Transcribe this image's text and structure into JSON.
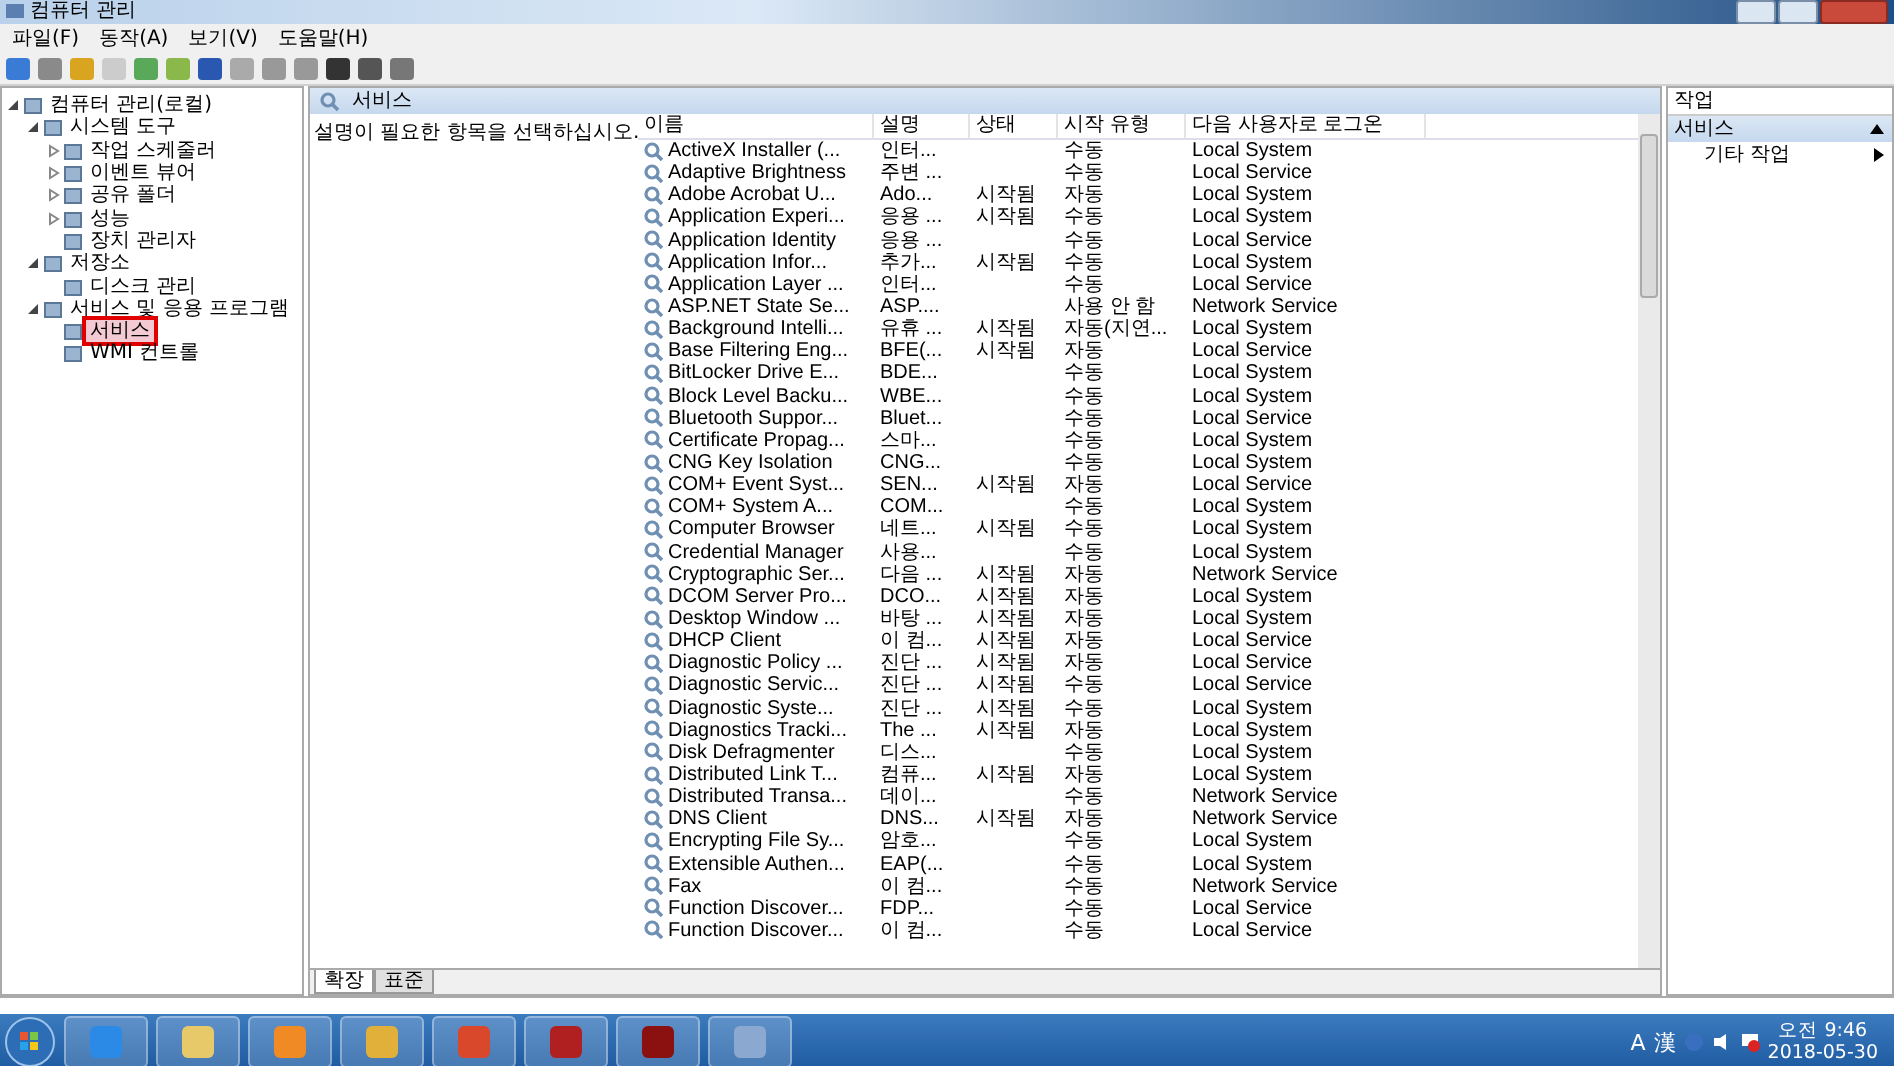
{
  "window": {
    "title": "컴퓨터 관리"
  },
  "menu": [
    "파일(F)",
    "동작(A)",
    "보기(V)",
    "도움말(H)"
  ],
  "tree": [
    {
      "label": "컴퓨터 관리(로컬)",
      "expanded": true,
      "selected": false,
      "children": [
        {
          "label": "시스템 도구",
          "expanded": true,
          "selected": false,
          "children": [
            {
              "label": "작업 스케줄러",
              "expanded": false,
              "selected": false
            },
            {
              "label": "이벤트 뷰어",
              "expanded": false,
              "selected": false
            },
            {
              "label": "공유 폴더",
              "expanded": false,
              "selected": false
            },
            {
              "label": "성능",
              "expanded": false,
              "selected": false
            },
            {
              "label": "장치 관리자",
              "selected": false
            }
          ]
        },
        {
          "label": "저장소",
          "expanded": true,
          "selected": false,
          "children": [
            {
              "label": "디스크 관리",
              "selected": false
            }
          ]
        },
        {
          "label": "서비스 및 응용 프로그램",
          "expanded": true,
          "selected": false,
          "children": [
            {
              "label": "서비스",
              "selected": true
            },
            {
              "label": "WMI 컨트롤",
              "selected": false
            }
          ]
        }
      ]
    }
  ],
  "center": {
    "title": "서비스",
    "description": "설명이 필요한 항목을 선택하십시오.",
    "columns": [
      "이름",
      "설명",
      "상태",
      "시작 유형",
      "다음 사용자로 로그온"
    ],
    "rows": [
      [
        "ActiveX Installer (...",
        "인터...",
        "",
        "수동",
        "Local System"
      ],
      [
        "Adaptive Brightness",
        "주변 ...",
        "",
        "수동",
        "Local Service"
      ],
      [
        "Adobe Acrobat U...",
        "Ado...",
        "시작됨",
        "자동",
        "Local System"
      ],
      [
        "Application Experi...",
        "응용 ...",
        "시작됨",
        "수동",
        "Local System"
      ],
      [
        "Application Identity",
        "응용 ...",
        "",
        "수동",
        "Local Service"
      ],
      [
        "Application Infor...",
        "추가...",
        "시작됨",
        "수동",
        "Local System"
      ],
      [
        "Application Layer ...",
        "인터...",
        "",
        "수동",
        "Local Service"
      ],
      [
        "ASP.NET State Se...",
        "ASP....",
        "",
        "사용 안 함",
        "Network Service"
      ],
      [
        "Background Intelli...",
        "유휴 ...",
        "시작됨",
        "자동(지연...",
        "Local System"
      ],
      [
        "Base Filtering Eng...",
        "BFE(...",
        "시작됨",
        "자동",
        "Local Service"
      ],
      [
        "BitLocker Drive E...",
        "BDE...",
        "",
        "수동",
        "Local System"
      ],
      [
        "Block Level Backu...",
        "WBE...",
        "",
        "수동",
        "Local System"
      ],
      [
        "Bluetooth Suppor...",
        "Bluet...",
        "",
        "수동",
        "Local Service"
      ],
      [
        "Certificate Propag...",
        "스마...",
        "",
        "수동",
        "Local System"
      ],
      [
        "CNG Key Isolation",
        "CNG...",
        "",
        "수동",
        "Local System"
      ],
      [
        "COM+ Event Syst...",
        "SEN...",
        "시작됨",
        "자동",
        "Local Service"
      ],
      [
        "COM+ System A...",
        "COM...",
        "",
        "수동",
        "Local System"
      ],
      [
        "Computer Browser",
        "네트...",
        "시작됨",
        "수동",
        "Local System"
      ],
      [
        "Credential Manager",
        "사용...",
        "",
        "수동",
        "Local System"
      ],
      [
        "Cryptographic Ser...",
        "다음 ...",
        "시작됨",
        "자동",
        "Network Service"
      ],
      [
        "DCOM Server Pro...",
        "DCO...",
        "시작됨",
        "자동",
        "Local System"
      ],
      [
        "Desktop Window ...",
        "바탕 ...",
        "시작됨",
        "자동",
        "Local System"
      ],
      [
        "DHCP Client",
        "이 컴...",
        "시작됨",
        "자동",
        "Local Service"
      ],
      [
        "Diagnostic Policy ...",
        "진단 ...",
        "시작됨",
        "자동",
        "Local Service"
      ],
      [
        "Diagnostic Servic...",
        "진단 ...",
        "시작됨",
        "수동",
        "Local Service"
      ],
      [
        "Diagnostic Syste...",
        "진단 ...",
        "시작됨",
        "수동",
        "Local System"
      ],
      [
        "Diagnostics Tracki...",
        "The ...",
        "시작됨",
        "자동",
        "Local System"
      ],
      [
        "Disk Defragmenter",
        "디스...",
        "",
        "수동",
        "Local System"
      ],
      [
        "Distributed Link T...",
        "컴퓨...",
        "시작됨",
        "자동",
        "Local System"
      ],
      [
        "Distributed Transa...",
        "데이...",
        "",
        "수동",
        "Network Service"
      ],
      [
        "DNS Client",
        "DNS...",
        "시작됨",
        "자동",
        "Network Service"
      ],
      [
        "Encrypting File Sy...",
        "암호...",
        "",
        "수동",
        "Local System"
      ],
      [
        "Extensible Authen...",
        "EAP(...",
        "",
        "수동",
        "Local System"
      ],
      [
        "Fax",
        "이 컴...",
        "",
        "수동",
        "Network Service"
      ],
      [
        "Function Discover...",
        "FDP...",
        "",
        "수동",
        "Local Service"
      ],
      [
        "Function Discover...",
        "이 컴...",
        "",
        "수동",
        "Local Service"
      ]
    ],
    "tabs": [
      {
        "label": "확장",
        "selected": true
      },
      {
        "label": "표준",
        "selected": false
      }
    ]
  },
  "actions": {
    "title": "작업",
    "sections": [
      {
        "label": "서비스",
        "selected": true,
        "items": [
          "기타 작업"
        ]
      }
    ]
  },
  "taskbar": {
    "tray": [
      "A",
      "漢"
    ],
    "time": "오전 9:46",
    "date": "2018-05-30"
  }
}
